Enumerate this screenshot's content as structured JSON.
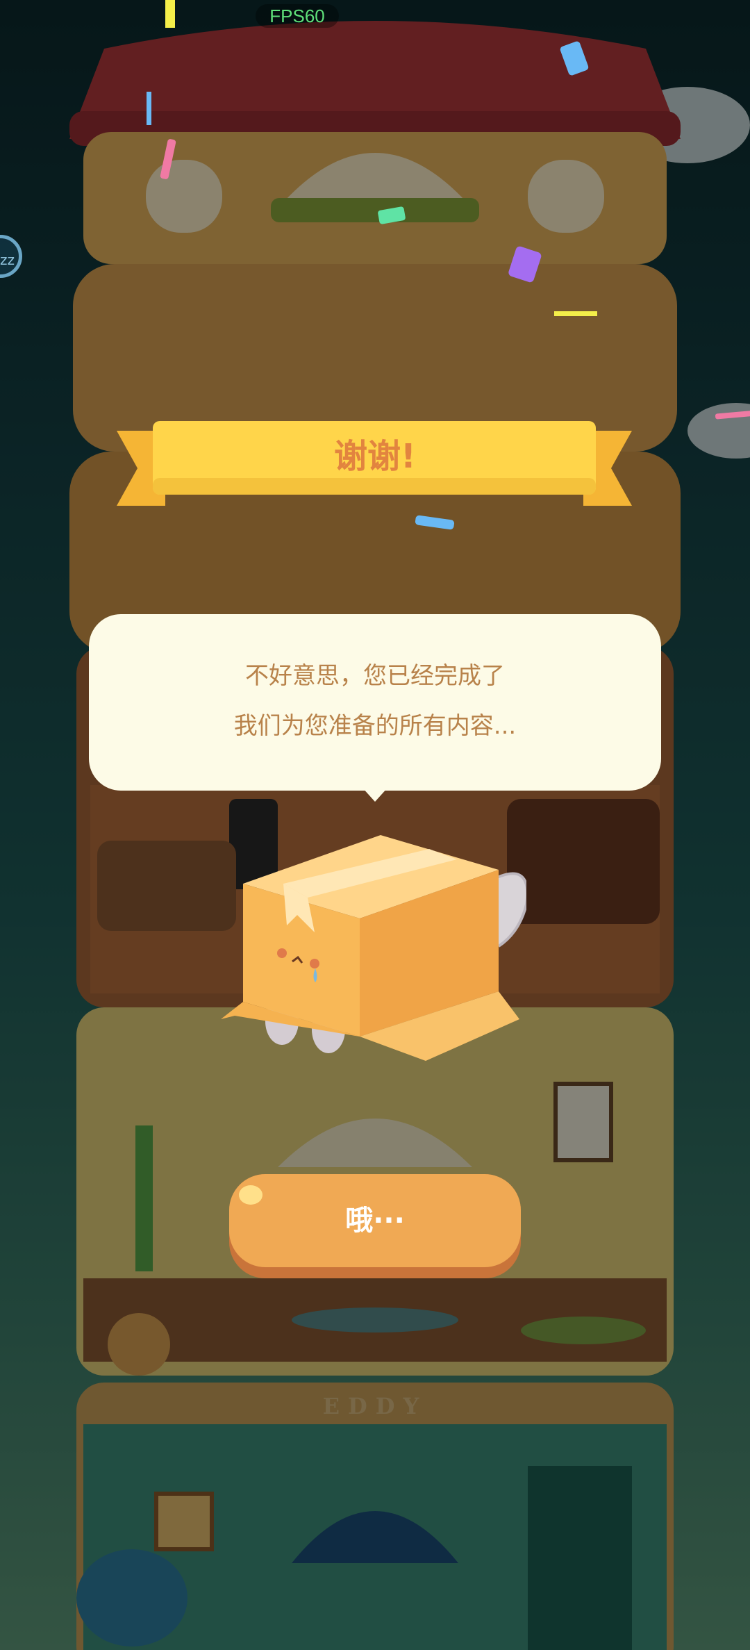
{
  "hud": {
    "fps": "FPS60",
    "zz": "zz"
  },
  "banner": {
    "title": "谢谢!"
  },
  "dialog": {
    "line1": "不好意思，您已经完成了",
    "line2": "我们为您准备的所有内容..."
  },
  "button": {
    "label": "哦···"
  },
  "sign": {
    "text": "EDDY"
  },
  "colors": {
    "banner": "#ffd54a",
    "bubble": "#fdfbe7",
    "button": "#f0a954",
    "text_accent": "#e2843f"
  }
}
